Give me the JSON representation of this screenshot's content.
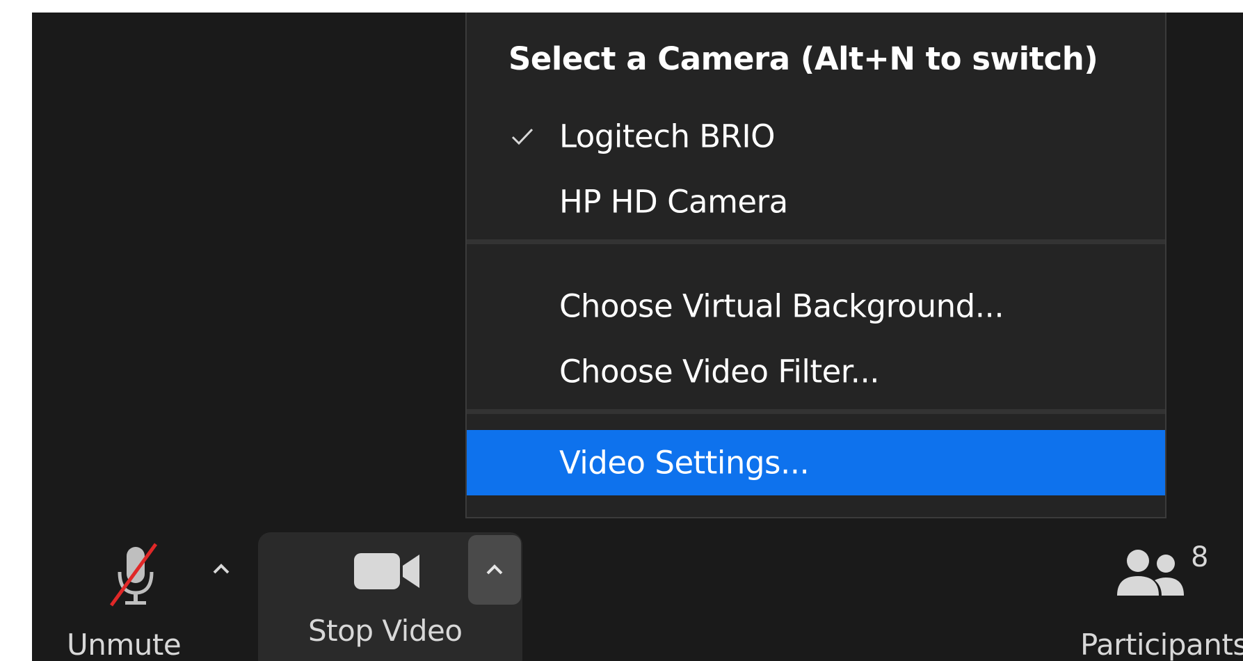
{
  "camera_menu": {
    "header": "Select a Camera (Alt+N to switch)",
    "cameras": [
      {
        "label": "Logitech BRIO",
        "selected": true
      },
      {
        "label": "HP HD Camera",
        "selected": false
      }
    ],
    "background_items": [
      {
        "label": "Choose Virtual Background..."
      },
      {
        "label": "Choose Video Filter..."
      }
    ],
    "settings_item": {
      "label": "Video Settings...",
      "highlighted": true
    }
  },
  "toolbar": {
    "unmute_label": "Unmute",
    "stop_video_label": "Stop Video",
    "participants_label": "Participants",
    "participants_count": "8"
  },
  "colors": {
    "highlight": "#0e72ed",
    "background": "#1a1a1a",
    "menu_bg": "#242424",
    "muted_slash": "#e02828"
  },
  "icons": [
    "check-icon",
    "microphone-muted-icon",
    "caret-up-icon",
    "video-camera-icon",
    "participants-icon"
  ]
}
